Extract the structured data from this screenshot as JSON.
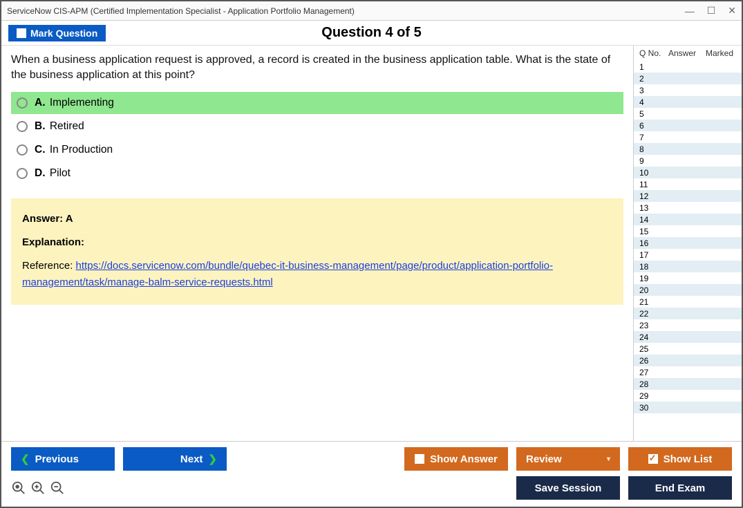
{
  "window": {
    "title": "ServiceNow CIS-APM (Certified Implementation Specialist - Application Portfolio Management)"
  },
  "header": {
    "mark_label": "Mark Question",
    "question_indicator": "Question 4 of 5"
  },
  "question": {
    "text": "When a business application request is approved, a record is created in the business application table. What is the state of the business application at this point?",
    "choices": [
      {
        "letter": "A.",
        "text": "Implementing",
        "highlight": true
      },
      {
        "letter": "B.",
        "text": "Retired",
        "highlight": false
      },
      {
        "letter": "C.",
        "text": "In Production",
        "highlight": false
      },
      {
        "letter": "D.",
        "text": "Pilot",
        "highlight": false
      }
    ]
  },
  "answer_panel": {
    "answer_label": "Answer: A",
    "explanation_label": "Explanation:",
    "reference_label": "Reference: ",
    "reference_link": "https://docs.servicenow.com/bundle/quebec-it-business-management/page/product/application-portfolio-management/task/manage-balm-service-requests.html"
  },
  "sidepanel": {
    "headers": {
      "qno": "Q No.",
      "answer": "Answer",
      "marked": "Marked"
    },
    "rows": [
      1,
      2,
      3,
      4,
      5,
      6,
      7,
      8,
      9,
      10,
      11,
      12,
      13,
      14,
      15,
      16,
      17,
      18,
      19,
      20,
      21,
      22,
      23,
      24,
      25,
      26,
      27,
      28,
      29,
      30
    ]
  },
  "footer": {
    "previous": "Previous",
    "next": "Next",
    "show_answer": "Show Answer",
    "review": "Review",
    "show_list": "Show List",
    "save_session": "Save Session",
    "end_exam": "End Exam"
  }
}
